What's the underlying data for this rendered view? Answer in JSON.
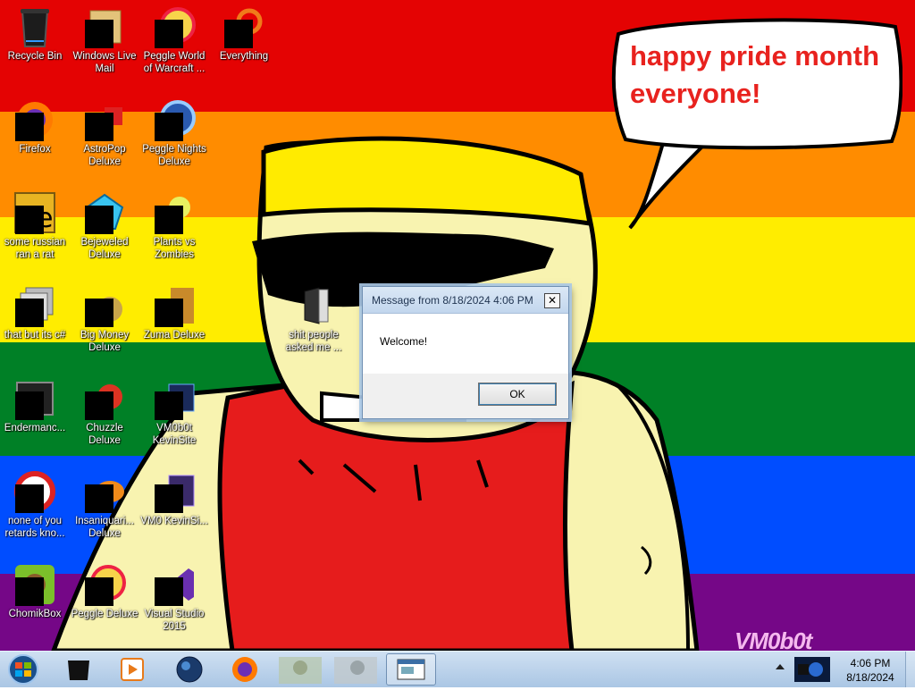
{
  "wallpaper": {
    "speech_text": "happy pride month everyone!",
    "watermark": "VM0b0t",
    "colors": [
      "#e40303",
      "#ff8c00",
      "#ffed00",
      "#008026",
      "#004dff",
      "#750787"
    ]
  },
  "desktop_icons": [
    {
      "label": "Recycle Bin",
      "icon": "recycle-bin-icon"
    },
    {
      "label": "Windows Live Mail",
      "icon": "mail-icon"
    },
    {
      "label": "Peggle World of Warcraft ...",
      "icon": "peggle-icon"
    },
    {
      "label": "Everything",
      "icon": "search-icon"
    },
    {
      "label": "Firefox",
      "icon": "firefox-icon"
    },
    {
      "label": "AstroPop Deluxe",
      "icon": "game-icon"
    },
    {
      "label": "Peggle Nights Deluxe",
      "icon": "peggle-icon"
    },
    {
      "label": "some russian ran a rat",
      "icon": "app-icon"
    },
    {
      "label": "Bejeweled Deluxe",
      "icon": "gem-icon"
    },
    {
      "label": "Plants vs Zombies",
      "icon": "plant-icon"
    },
    {
      "label": "that but its c#",
      "icon": "folder-icon"
    },
    {
      "label": "Big Money Deluxe",
      "icon": "money-bag-icon"
    },
    {
      "label": "Zuma Deluxe",
      "icon": "frog-icon"
    },
    {
      "label": "Endermanc...",
      "icon": "console-icon"
    },
    {
      "label": "Chuzzle Deluxe",
      "icon": "game-icon"
    },
    {
      "label": "VM0b0t KevinSite",
      "icon": "site-icon"
    },
    {
      "label": "none of you retards kno...",
      "icon": "app-icon"
    },
    {
      "label": "Insaniquari... Deluxe",
      "icon": "fish-icon"
    },
    {
      "label": "VM0 KevinSi...",
      "icon": "site-icon"
    },
    {
      "label": "ChomikBox",
      "icon": "hamster-icon"
    },
    {
      "label": "Peggle Deluxe",
      "icon": "peggle-icon"
    },
    {
      "label": "Visual Studio 2015",
      "icon": "visual-studio-icon"
    },
    {
      "label": "shit people asked me ...",
      "icon": "folder-icon"
    }
  ],
  "dialog": {
    "title": "Message from  8/18/2024 4:06 PM",
    "message": "Welcome!",
    "ok_label": "OK",
    "close_glyph": "✕"
  },
  "taskbar": {
    "start": "start-orb-icon",
    "pinned": [
      "recycle-bin-icon",
      "media-player-icon",
      "globe-icon",
      "firefox-icon",
      "thumbnail-icon",
      "thumbnail-icon",
      "window-icon"
    ],
    "clock_time": "4:06 PM",
    "clock_date": "8/18/2024"
  }
}
